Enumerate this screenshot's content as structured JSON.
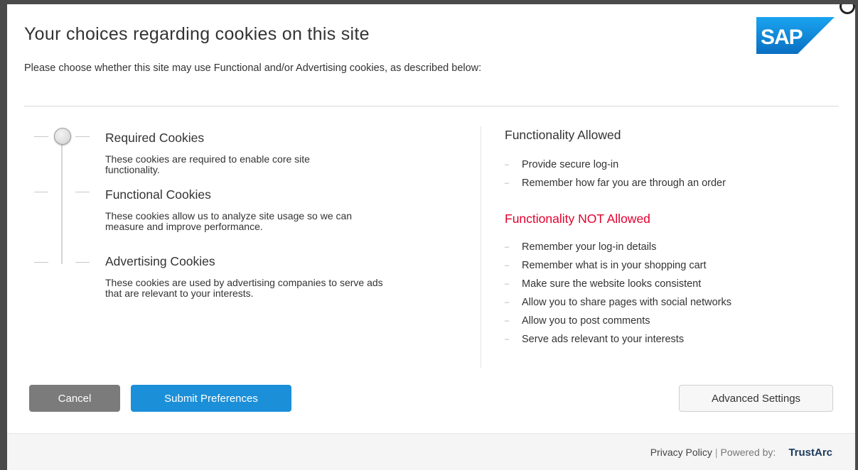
{
  "dialog": {
    "title": "Your choices regarding cookies on this site",
    "subtitle": "Please choose whether this site may use Functional and/or Advertising cookies, as described below:"
  },
  "logo": {
    "text": "SAP",
    "icon": "sap-logo"
  },
  "levels": [
    {
      "title": "Required Cookies",
      "description": "These cookies are required to enable core site functionality."
    },
    {
      "title": "Functional Cookies",
      "description": "These cookies allow us to analyze site usage so we can measure and improve performance."
    },
    {
      "title": "Advertising Cookies",
      "description": "These cookies are used by advertising companies to serve ads that are relevant to your interests."
    }
  ],
  "slider": {
    "selected_level": "Required Cookies"
  },
  "allowed": {
    "heading": "Functionality Allowed",
    "items": [
      "Provide secure log-in",
      "Remember how far you are through an order"
    ]
  },
  "not_allowed": {
    "heading": "Functionality NOT Allowed",
    "heading_color": "#e3002d",
    "items": [
      "Remember your log-in details",
      "Remember what is in your shopping cart",
      "Make sure the website looks consistent",
      "Allow you to share pages with social networks",
      "Allow you to post comments",
      "Serve ads relevant to your interests"
    ]
  },
  "buttons": {
    "cancel": "Cancel",
    "submit": "Submit Preferences",
    "advanced": "Advanced Settings",
    "submit_color": "#1b8fd8",
    "cancel_color": "#7b7b7b"
  },
  "footer": {
    "privacy": "Privacy Policy",
    "separator": "|",
    "powered_by": "Powered by:",
    "brand": "TrustArc"
  }
}
